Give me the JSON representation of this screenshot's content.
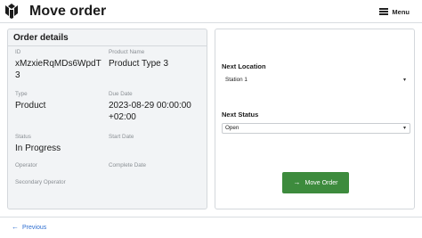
{
  "header": {
    "title": "Move order",
    "menu_label": "Menu"
  },
  "order_details": {
    "title": "Order details",
    "fields": [
      {
        "label": "ID",
        "value": "xMzxieRqMDs6WpdT3"
      },
      {
        "label": "Product Name",
        "value": "Product Type 3"
      },
      {
        "label": "Type",
        "value": "Product"
      },
      {
        "label": "Due Date",
        "value": "2023-08-29 00:00:00 +02:00"
      },
      {
        "label": "Status",
        "value": "In Progress"
      },
      {
        "label": "Start Date",
        "value": ""
      },
      {
        "label": "Operator",
        "value": ""
      },
      {
        "label": "Complete Date",
        "value": ""
      },
      {
        "label": "Secondary Operator",
        "value": ""
      }
    ]
  },
  "move_form": {
    "next_location_label": "Next Location",
    "next_location_value": "Station 1",
    "next_status_label": "Next Status",
    "next_status_value": "Open",
    "move_button_label": "Move Order"
  },
  "footer": {
    "previous_label": "Previous"
  },
  "colors": {
    "accent_green": "#3d8b3d",
    "link_blue": "#2f6fd1",
    "card_bg": "#f2f4f6"
  }
}
